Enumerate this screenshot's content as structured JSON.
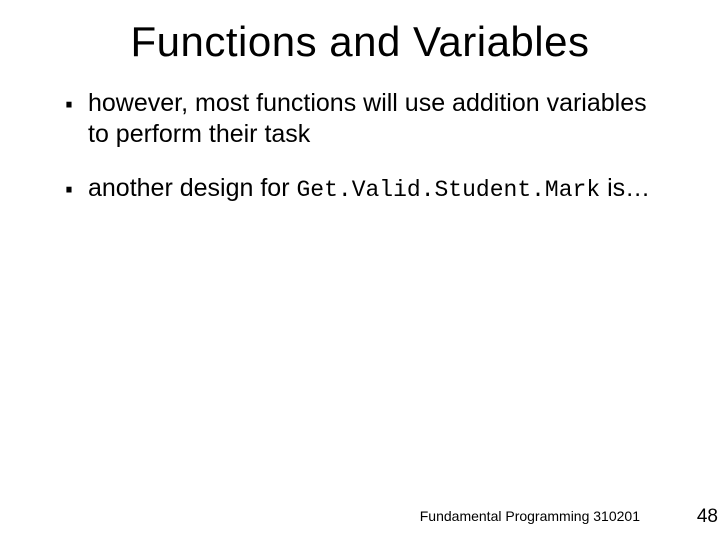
{
  "title": "Functions and Variables",
  "bullets": [
    {
      "pre": "however, most functions will use addition variables to perform their task",
      "code": "",
      "post": ""
    },
    {
      "pre": "another design for ",
      "code": "Get.Valid.Student.Mark",
      "post": " is…"
    }
  ],
  "footer": "Fundamental Programming 310201",
  "page_number": "48"
}
